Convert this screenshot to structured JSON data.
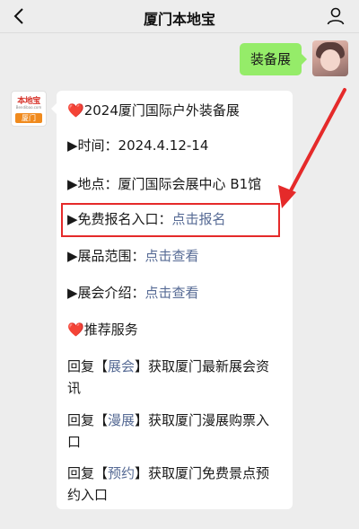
{
  "navbar": {
    "title": "厦门本地宝",
    "back_icon": "back-arrow-icon",
    "profile_icon": "person-icon"
  },
  "outgoing": {
    "text": "装备展"
  },
  "bot": {
    "logo_top": "本地宝",
    "logo_sub": "Bendibao.com",
    "logo_badge": "厦门"
  },
  "message": {
    "heading": "2024厦门国际户外装备展",
    "heading_icon": "❤️",
    "time_label": "▶时间：",
    "time_value": "2024.4.12-14",
    "place_label": "▶地点：",
    "place_value": "厦门国际会展中心 B1馆",
    "signup_label": "▶免费报名入口：",
    "signup_link": "点击报名",
    "scope_label": "▶展品范围：",
    "scope_link": "点击查看",
    "intro_label": "▶展会介绍：",
    "intro_link": "点击查看",
    "recommend": "推荐服务",
    "reply1_prefix": "回复【",
    "reply1_key": "展会",
    "reply1_suffix": "】获取厦门最新展会资讯",
    "reply2_prefix": "回复【",
    "reply2_key": "漫展",
    "reply2_suffix": "】获取厦门漫展购票入口",
    "reply3_prefix": "回复【",
    "reply3_key": "预约",
    "reply3_suffix": "】获取厦门免费景点预约入口"
  },
  "colors": {
    "link": "#576b95",
    "highlight": "#e52a2a",
    "bubble_out": "#95ec69",
    "background": "#ededed"
  }
}
